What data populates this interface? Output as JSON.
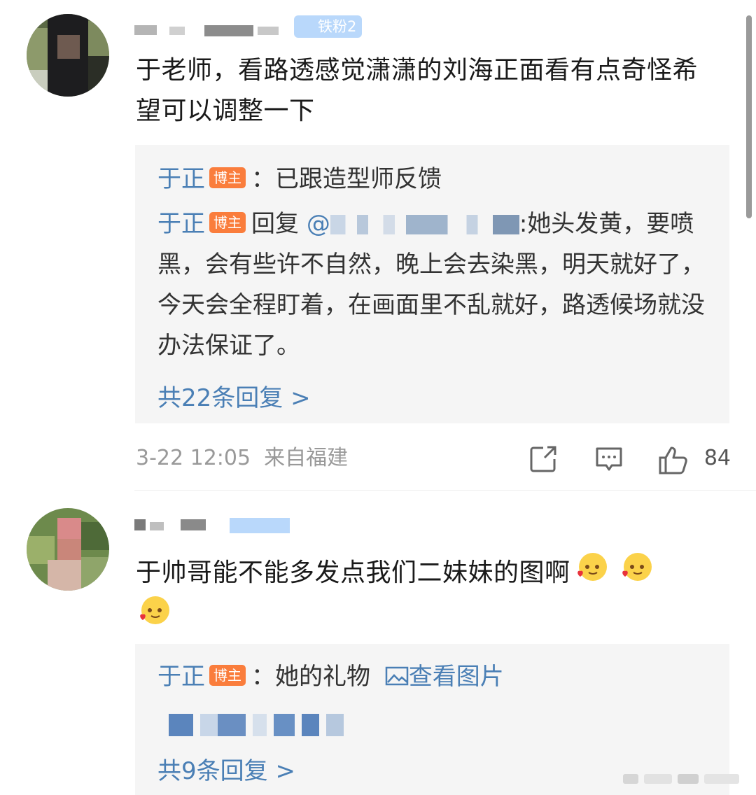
{
  "comments": [
    {
      "fan_badge": "铁粉2",
      "text": "于老师，看路透感觉潇潇的刘海正面看有点奇怪希望可以调整一下",
      "replies": [
        {
          "author": "于正",
          "tag": "博主",
          "text": "：已跟造型师反馈"
        },
        {
          "author": "于正",
          "tag": "博主",
          "prefix": "回复",
          "mention": "@",
          "text": ":她头发黄，要喷黑，会有些许不自然，晚上会去染黑，明天就好了，今天会全程盯着，在画面里不乱就好，路透候场就没办法保证了。"
        }
      ],
      "more_replies": "共22条回复 >",
      "time": "3-22 12:05",
      "location": "来自福建",
      "like_count": "84"
    },
    {
      "text": "于帅哥能不能多发点我们二妹妹的图啊",
      "emoji": "heart-face-emoji",
      "replies": [
        {
          "author": "于正",
          "tag": "博主",
          "text": "：她的礼物",
          "link": "查看图片"
        }
      ],
      "more_replies": "共9条回复 >"
    }
  ],
  "colors": {
    "link_blue": "#4a7fb5",
    "blogger_tag": "#fa7d3c",
    "reply_bg": "#f5f5f5",
    "meta_gray": "#999999"
  },
  "icons": [
    "share-icon",
    "comment-icon",
    "like-icon",
    "image-icon"
  ]
}
